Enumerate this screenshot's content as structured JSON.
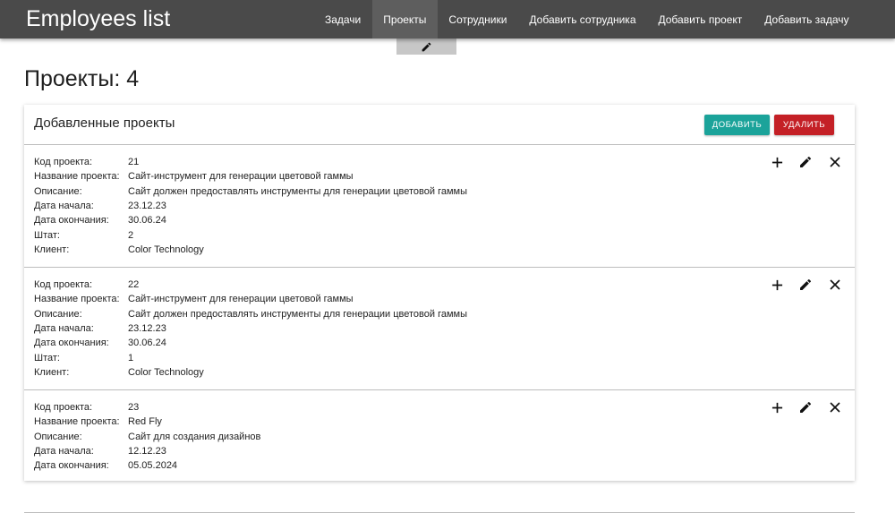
{
  "app": {
    "brand": "Employees list"
  },
  "nav": {
    "items": [
      {
        "label": "Задачи",
        "active": false
      },
      {
        "label": "Проекты",
        "active": true
      },
      {
        "label": "Сотрудники",
        "active": false
      },
      {
        "label": "Добавить сотрудника",
        "active": false
      },
      {
        "label": "Добавить проект",
        "active": false
      },
      {
        "label": "Добавить задачу",
        "active": false
      }
    ],
    "active_tab_icon": "pencil-icon"
  },
  "page": {
    "title": "Проекты: 4"
  },
  "card": {
    "title": "Добавленные проекты",
    "add_label": "Добавить",
    "delete_label": "Удалить",
    "field_labels": {
      "code": "Код проекта:",
      "name": "Название проекта:",
      "description": "Описание:",
      "start": "Дата начала:",
      "end": "Дата окончания:",
      "staff": "Штат:",
      "client": "Клиент:"
    }
  },
  "projects": [
    {
      "code": "21",
      "name": "Сайт-инструмент для генерации цветовой гаммы",
      "description": "Сайт должен предоставлять инструменты для генерации цветовой гаммы",
      "start": "23.12.23",
      "end": "30.06.24",
      "staff": "2",
      "client": "Color Technology"
    },
    {
      "code": "22",
      "name": "Сайт-инструмент для генерации цветовой гаммы",
      "description": "Сайт должен предоставлять инструменты для генерации цветовой гаммы",
      "start": "23.12.23",
      "end": "30.06.24",
      "staff": "1",
      "client": "Color Technology"
    },
    {
      "code": "23",
      "name": "Red Fly",
      "description": "Сайт для создания дизайнов",
      "start": "12.12.23",
      "end": "05.05.2024"
    }
  ],
  "row_actions": [
    "plus-icon",
    "pencil-icon",
    "close-icon"
  ],
  "colors": {
    "navbar": "#4a4a4a",
    "nav_active": "#5e5e5e",
    "add_button": "#1ba39a",
    "delete_button": "#c42026"
  }
}
